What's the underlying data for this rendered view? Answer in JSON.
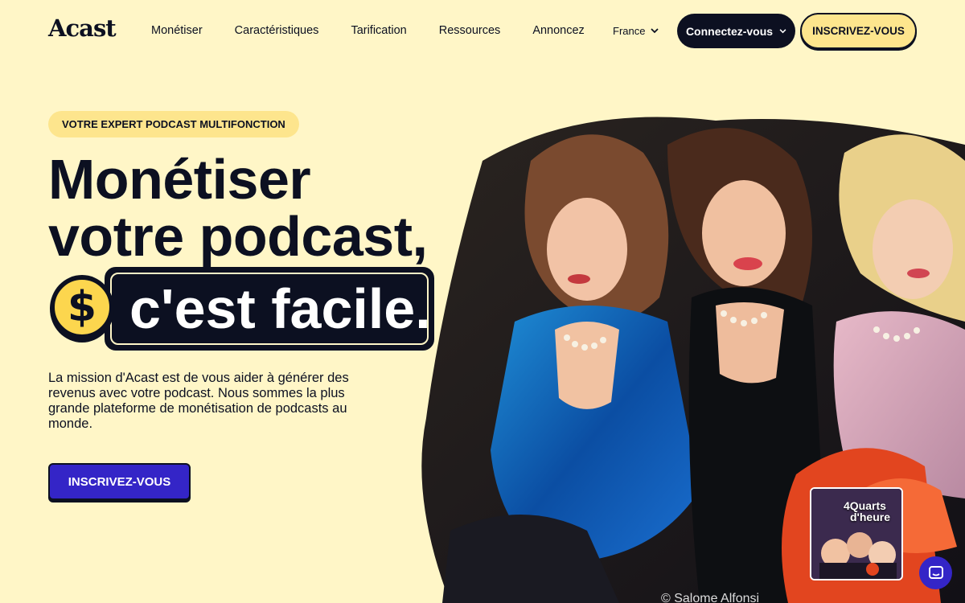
{
  "nav": {
    "logo": "Acast",
    "links": [
      "Monétiser",
      "Caractéristiques",
      "Tarification",
      "Ressources",
      "Annoncez"
    ],
    "country": "France",
    "connect_label": "Connectez-vous",
    "signup_label": "INSCRIVEZ-VOUS"
  },
  "hero": {
    "tagline": "VOTRE EXPERT PODCAST MULTIFONCTION",
    "headline_1": "Monétiser",
    "headline_2": "votre podcast,",
    "headline_3": "c'est facile.",
    "coin_symbol": "$",
    "description": "La mission d'Acast est de vous aider à générer des revenus avec votre podcast. Nous sommes la plus grande plateforme de monétisation de podcasts au monde.",
    "cta_label": "INSCRIVEZ-VOUS",
    "photo_credit": "© Salome Alfonsi",
    "episode_title_1": "4Quarts",
    "episode_title_2": "d'heure"
  },
  "colors": {
    "background": "#fff6c7",
    "accent_yellow": "#fde58d",
    "navy": "#0c1021",
    "primary_blue": "#3425c7"
  },
  "icons": {
    "country_chevron": "chevron-down-icon",
    "connect_chevron": "chevron-down-icon",
    "coin": "dollar-coin-icon",
    "chat": "chat-icon"
  }
}
